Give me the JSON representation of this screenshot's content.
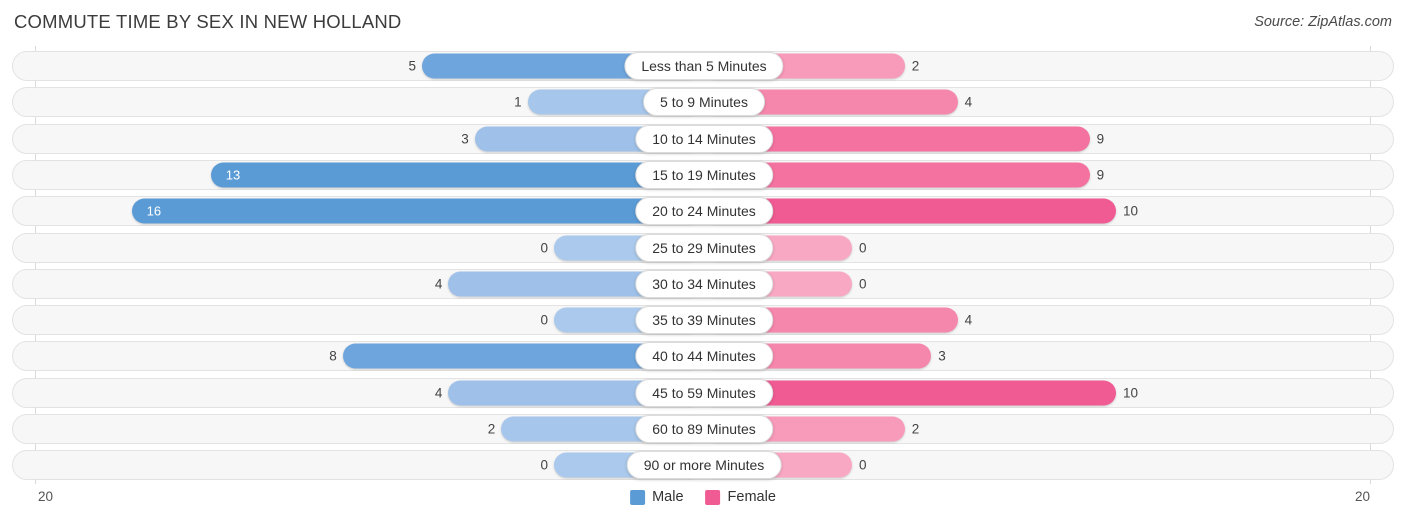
{
  "header": {
    "title": "COMMUTE TIME BY SEX IN NEW HOLLAND",
    "source": "Source: ZipAtlas.com"
  },
  "axis": {
    "left_tick": "20",
    "right_tick": "20"
  },
  "legend": {
    "items": [
      {
        "label": "Male",
        "color": "#5b9bd5"
      },
      {
        "label": "Female",
        "color": "#ef5b92"
      }
    ]
  },
  "chart_data": {
    "type": "bar",
    "title": "COMMUTE TIME BY SEX IN NEW HOLLAND",
    "subtitle": "Source: ZipAtlas.com",
    "orientation": "horizontal-diverging",
    "xlabel": "",
    "ylabel": "",
    "xlim": [
      20,
      20
    ],
    "grid": false,
    "legend_position": "bottom-center",
    "categories": [
      "Less than 5 Minutes",
      "5 to 9 Minutes",
      "10 to 14 Minutes",
      "15 to 19 Minutes",
      "20 to 24 Minutes",
      "25 to 29 Minutes",
      "30 to 34 Minutes",
      "35 to 39 Minutes",
      "40 to 44 Minutes",
      "45 to 59 Minutes",
      "60 to 89 Minutes",
      "90 or more Minutes"
    ],
    "series": [
      {
        "name": "Male",
        "side": "left",
        "values": [
          5,
          1,
          3,
          13,
          16,
          0,
          4,
          0,
          8,
          4,
          2,
          0
        ]
      },
      {
        "name": "Female",
        "side": "right",
        "values": [
          2,
          4,
          9,
          9,
          10,
          0,
          0,
          4,
          3,
          10,
          2,
          0
        ]
      }
    ],
    "value_labels": {
      "male": [
        "5",
        "1",
        "3",
        "13",
        "16",
        "0",
        "4",
        "0",
        "8",
        "4",
        "2",
        "0"
      ],
      "female": [
        "2",
        "4",
        "9",
        "9",
        "10",
        "0",
        "0",
        "4",
        "3",
        "10",
        "2",
        "0"
      ]
    }
  },
  "rows": [
    {
      "label": "Less than 5 Minutes",
      "male": "5",
      "female": "2",
      "male_v": 5,
      "female_v": 2
    },
    {
      "label": "5 to 9 Minutes",
      "male": "1",
      "female": "4",
      "male_v": 1,
      "female_v": 4
    },
    {
      "label": "10 to 14 Minutes",
      "male": "3",
      "female": "9",
      "male_v": 3,
      "female_v": 9
    },
    {
      "label": "15 to 19 Minutes",
      "male": "13",
      "female": "9",
      "male_v": 13,
      "female_v": 9
    },
    {
      "label": "20 to 24 Minutes",
      "male": "16",
      "female": "10",
      "male_v": 16,
      "female_v": 10
    },
    {
      "label": "25 to 29 Minutes",
      "male": "0",
      "female": "0",
      "male_v": 0,
      "female_v": 0
    },
    {
      "label": "30 to 34 Minutes",
      "male": "4",
      "female": "0",
      "male_v": 4,
      "female_v": 0
    },
    {
      "label": "35 to 39 Minutes",
      "male": "0",
      "female": "4",
      "male_v": 0,
      "female_v": 4
    },
    {
      "label": "40 to 44 Minutes",
      "male": "8",
      "female": "3",
      "male_v": 8,
      "female_v": 3
    },
    {
      "label": "45 to 59 Minutes",
      "male": "4",
      "female": "10",
      "male_v": 4,
      "female_v": 10
    },
    {
      "label": "60 to 89 Minutes",
      "male": "2",
      "female": "2",
      "male_v": 2,
      "female_v": 2
    },
    {
      "label": "90 or more Minutes",
      "male": "0",
      "female": "0",
      "male_v": 0,
      "female_v": 0
    }
  ]
}
